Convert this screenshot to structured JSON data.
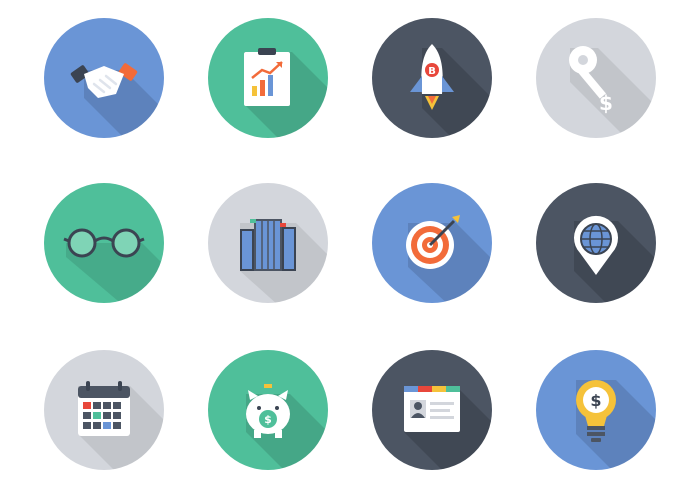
{
  "icons": [
    {
      "name": "handshake-icon",
      "background": "#6a95d6"
    },
    {
      "name": "clipboard-chart-icon",
      "background": "#4fbf9a"
    },
    {
      "name": "bitcoin-rocket-icon",
      "background": "#4c5563"
    },
    {
      "name": "dollar-key-icon",
      "background": "#d3d6dc"
    },
    {
      "name": "glasses-icon",
      "background": "#4fbf9a"
    },
    {
      "name": "office-buildings-icon",
      "background": "#d3d6dc"
    },
    {
      "name": "target-arrow-icon",
      "background": "#6a95d6"
    },
    {
      "name": "globe-location-pin-icon",
      "background": "#4c5563"
    },
    {
      "name": "calendar-icon",
      "background": "#d3d6dc"
    },
    {
      "name": "piggy-bank-icon",
      "background": "#4fbf9a"
    },
    {
      "name": "profile-card-icon",
      "background": "#4c5563"
    },
    {
      "name": "dollar-lightbulb-icon",
      "background": "#6a95d6"
    }
  ],
  "colors": {
    "blue": "#6a95d6",
    "green": "#4fbf9a",
    "dark": "#4c5563",
    "gray": "#d3d6dc",
    "orange": "#f26b3a",
    "yellow": "#f5c23a",
    "red": "#e8473b"
  }
}
